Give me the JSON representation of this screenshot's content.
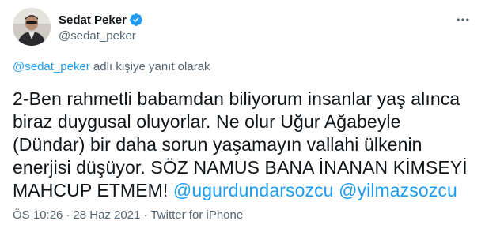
{
  "author": {
    "display_name": "Sedat Peker",
    "handle": "@sedat_peker",
    "verified_color": "#1d9bf0"
  },
  "reply_context": {
    "mention": "@sedat_peker",
    "suffix": " adlı kişiye yanıt olarak"
  },
  "tweet": {
    "lines": [
      "2-Ben rahmetli babamdan biliyorum insanlar yaş alınca",
      "biraz duygusal oluyorlar. Ne olur Uğur Ağabeyle",
      "(Dündar) bir daha sorun yaşamayın vallahi ülkenin",
      "enerjisi düşüyor. SÖZ NAMUS BANA İNANAN KİMSEYİ"
    ],
    "last_line_text": "MAHCUP ETMEM! ",
    "mention_1": "@ugurdundarsozcu",
    "mention_sep": " ",
    "mention_2": "@yilmazsozcu"
  },
  "meta": {
    "time": "ÖS 10:26",
    "separator": "·",
    "date": "28 Haz 2021",
    "source": "Twitter for iPhone"
  },
  "icons": {
    "verified": "verified-badge-icon",
    "more": "more-options-icon"
  },
  "colors": {
    "accent": "#1d9bf0",
    "text": "#0f1419",
    "secondary": "#536471"
  }
}
